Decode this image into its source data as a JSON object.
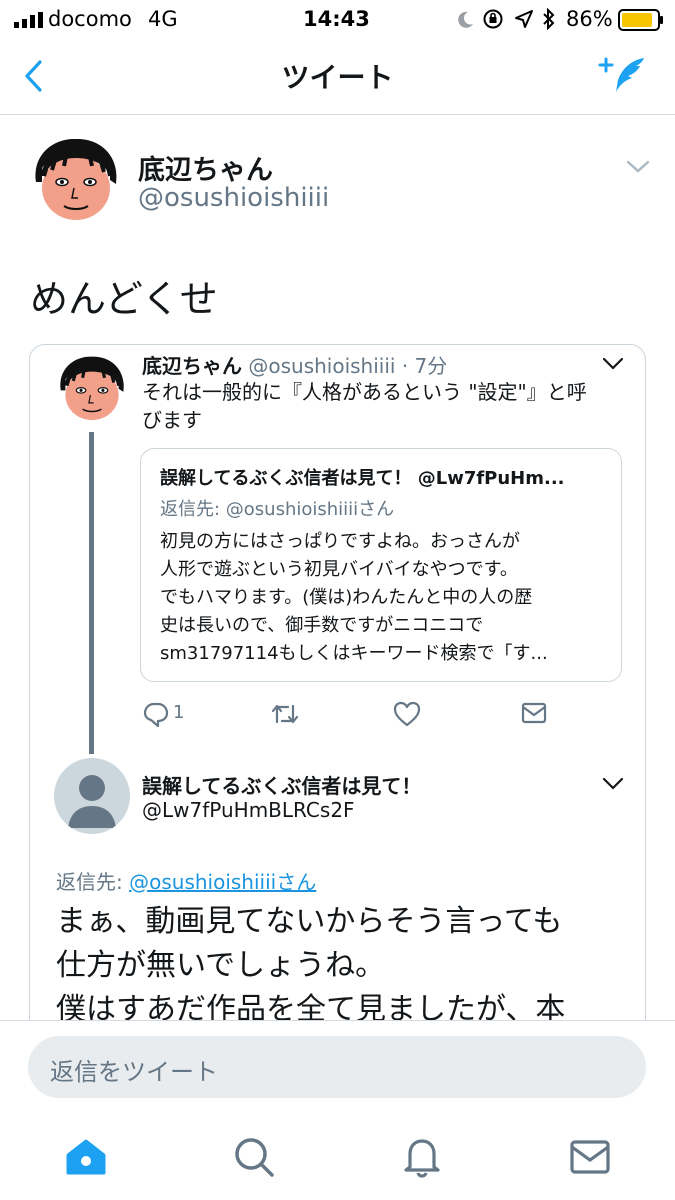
{
  "status_bar": {
    "carrier": "docomo",
    "network": "4G",
    "time": "14:43",
    "battery": "86%"
  },
  "nav": {
    "title": "ツイート"
  },
  "main_tweet": {
    "display_name": "底辺ちゃん",
    "handle": "@osushioishiiii",
    "text": "めんどくせ"
  },
  "quoted_tweet": {
    "display_name": "底辺ちゃん",
    "handle_time": "@osushioishiiii · 7分",
    "text_line1": "それは一般的に『人格があるという \"設定\"』と呼",
    "text_line2": "びます",
    "inner": {
      "header": "誤解してるぶくぶ信者は見て！ @Lw7fPuHm...",
      "reply_to": "返信先: @osushioishiiiiさん",
      "lines": [
        "初見の方にはさっぱりですよね。おっさんが",
        "人形で遊ぶという初見バイバイなやつです。",
        "でもハマります。(僕は)わんたんと中の人の歴",
        "史は長いので、御手数ですがニコニコで",
        "sm31797114もしくはキーワード検索で「す..."
      ]
    },
    "reply_count": "1",
    "reply_author": {
      "display_name": "誤解してるぶくぶ信者は見て！",
      "handle": "@Lw7fPuHmBLRCs2F"
    }
  },
  "reply": {
    "reply_to_prefix": "返信先: ",
    "reply_to_handle": "@osushioishiiiiさん",
    "line1": "まぁ、動画見てないからそう言っても",
    "line2": "仕方が無いでしょうね。",
    "line3": "僕はすあだ作品を全て見ましたが、本"
  },
  "composer": {
    "placeholder": "返信をツイート"
  },
  "colors": {
    "accent": "#1da1f2",
    "grey": "#657786"
  }
}
